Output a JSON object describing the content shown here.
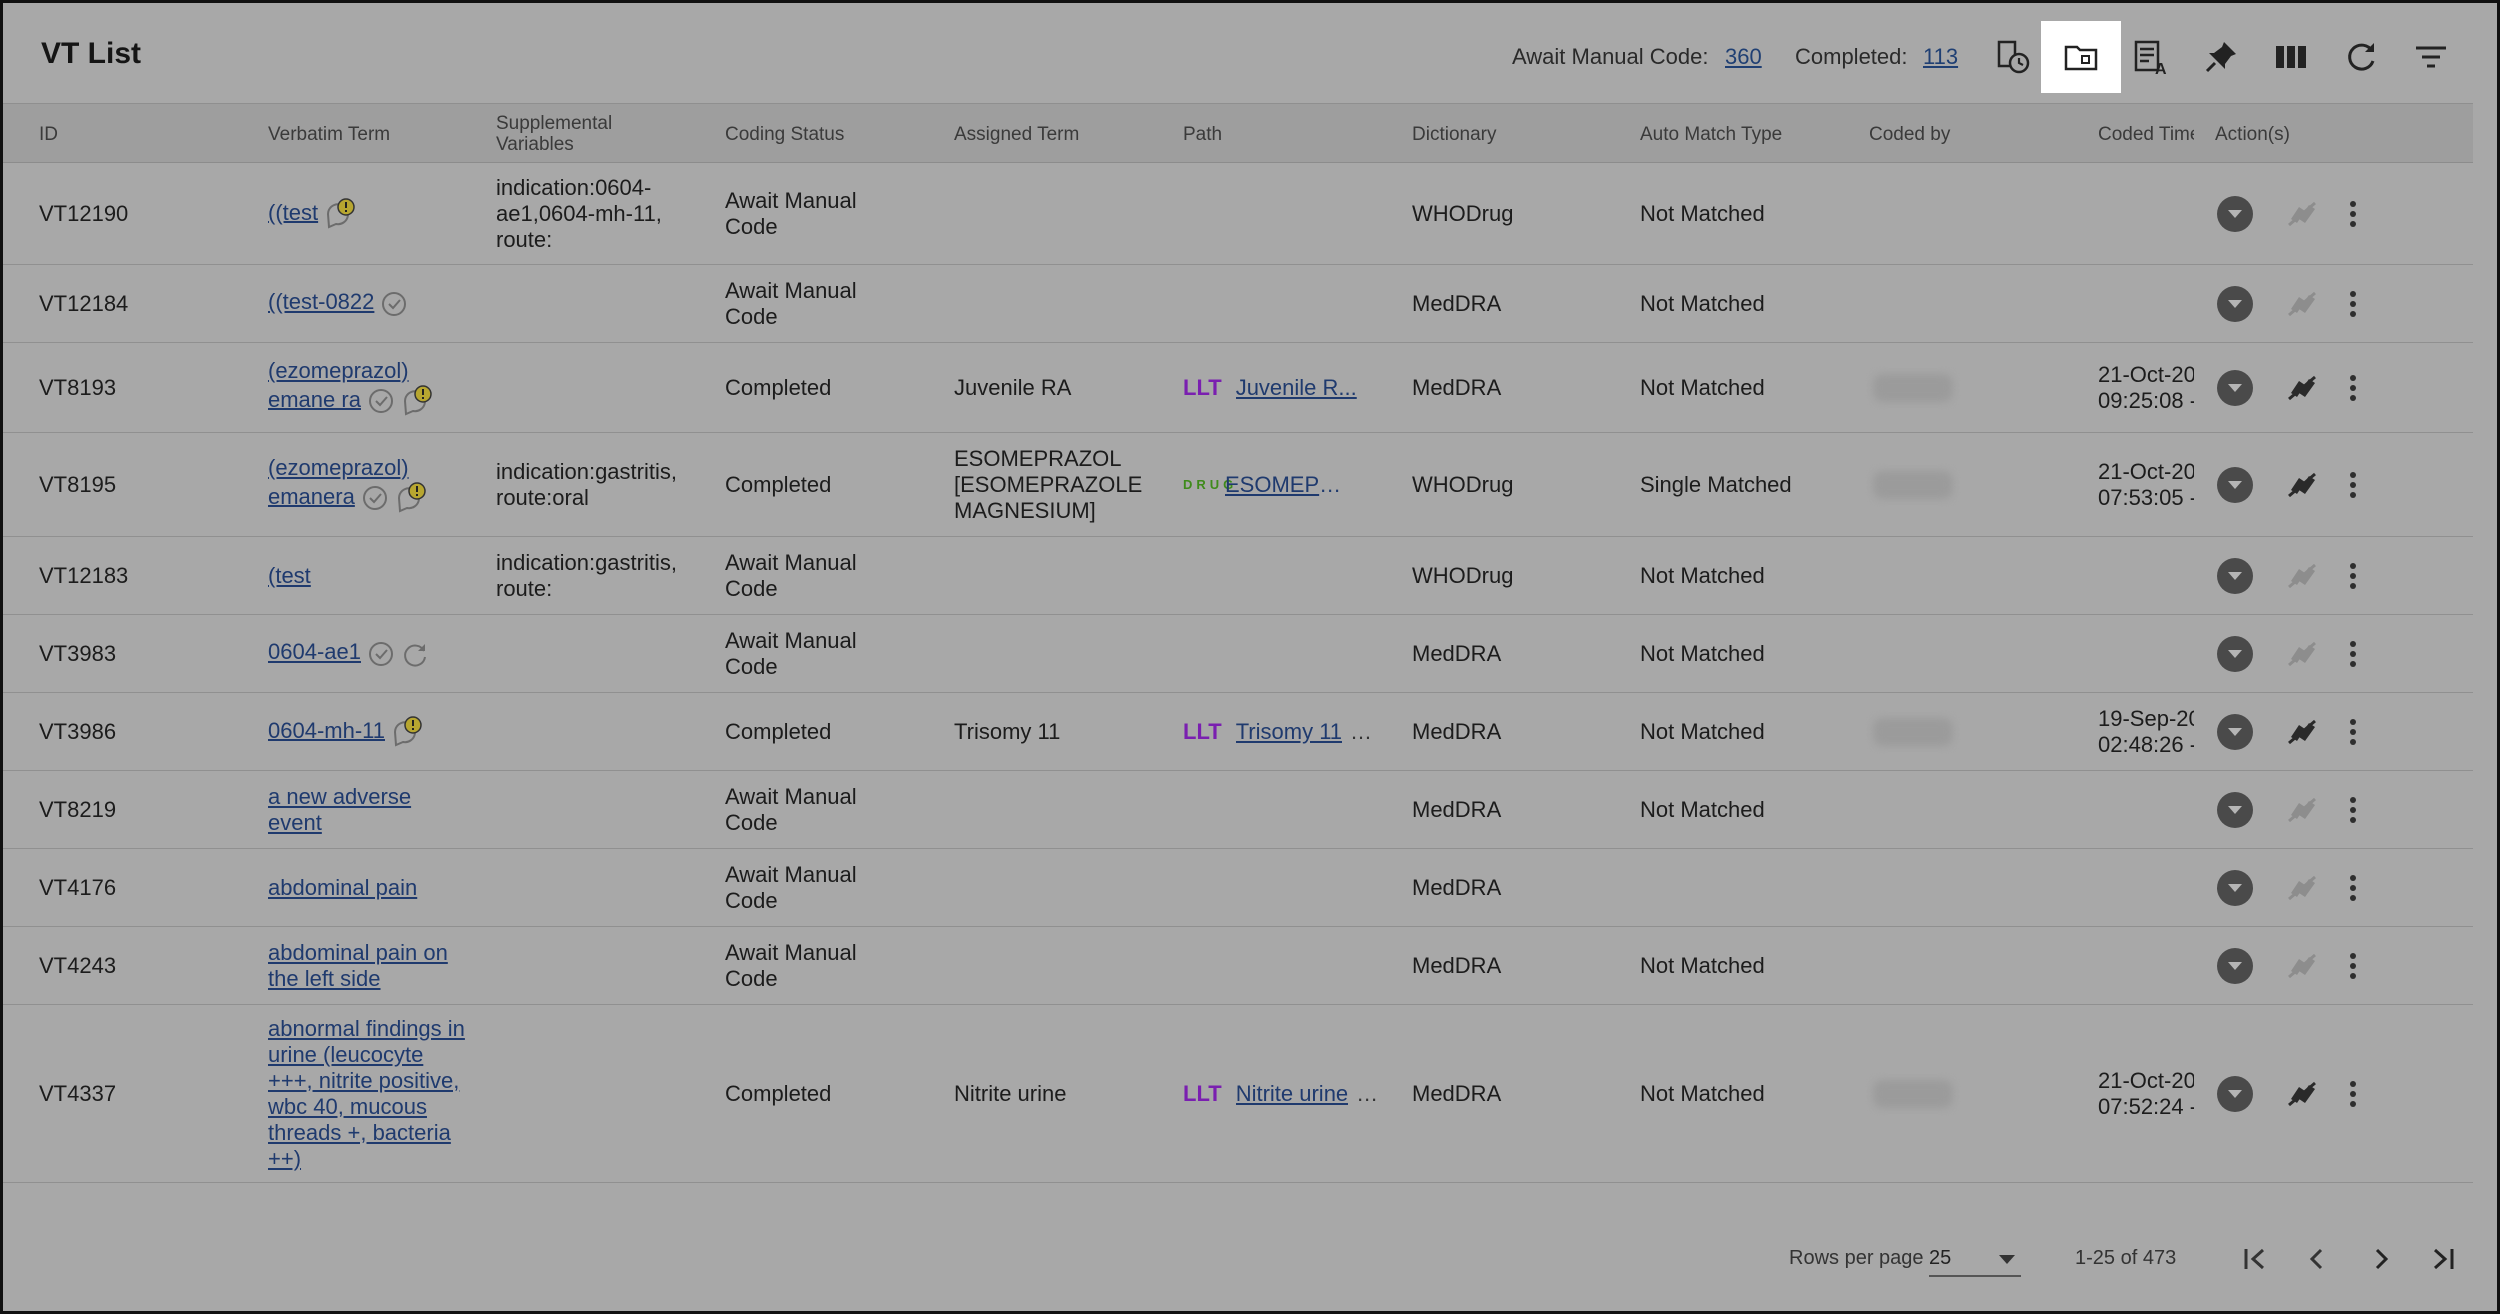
{
  "header": {
    "title": "VT List",
    "await_label": "Await Manual Code:",
    "await_count": "360",
    "completed_label": "Completed:",
    "completed_count": "113",
    "icons": [
      "history-icon",
      "folder-icon",
      "report-icon",
      "pin-icon",
      "columns-icon",
      "refresh-icon",
      "filter-icon"
    ]
  },
  "columns": {
    "id": "ID",
    "verbatim": "Verbatim Term",
    "supp": "Supplemental Variables",
    "status": "Coding Status",
    "assigned": "Assigned Term",
    "path": "Path",
    "dict": "Dictionary",
    "auto": "Auto Match Type",
    "coded_by": "Coded by",
    "coded_time": "Coded Time",
    "actions": "Action(s)"
  },
  "rows": [
    {
      "id": "VT12190",
      "verbatim": "((test",
      "supp": "indication:0604-ae1,0604-mh-11, route:",
      "status": "Await Manual Code",
      "assigned": "",
      "path_type": "",
      "path": "",
      "dict": "WHODrug",
      "auto": "Not Matched",
      "time1": "",
      "time2": "",
      "icons": [
        "query-warning-icon"
      ]
    },
    {
      "id": "VT12184",
      "verbatim": "((test-0822",
      "supp": "",
      "status": "Await Manual Code",
      "assigned": "",
      "path_type": "",
      "path": "",
      "dict": "MedDRA",
      "auto": "Not Matched",
      "time1": "",
      "time2": "",
      "icons": [
        "check-circle-icon"
      ]
    },
    {
      "id": "VT8193",
      "verbatim": "(ezomeprazol) emane ra",
      "supp": "",
      "status": "Completed",
      "assigned": "Juvenile RA",
      "path_type": "LLT",
      "path": "Juvenile R...",
      "dict": "MedDRA",
      "auto": "Not Matched",
      "time1": "21-Oct-20",
      "time2": "09:25:08 -",
      "icons": [
        "check-circle-icon",
        "query-warning-icon"
      ]
    },
    {
      "id": "VT8195",
      "verbatim": "(ezomeprazol) emanera",
      "supp": "indication:gastritis, route:oral",
      "status": "Completed",
      "assigned": "ESOMEPRAZOL [ESOMEPRAZOLE MAGNESIUM]",
      "path_type": "DRUG",
      "path": "ESOMEPRA...",
      "dict": "WHODrug",
      "auto": "Single Matched",
      "time1": "21-Oct-20",
      "time2": "07:53:05 -",
      "icons": [
        "check-circle-icon",
        "query-warning-icon"
      ]
    },
    {
      "id": "VT12183",
      "verbatim": "(test",
      "supp": "indication:gastritis, route:",
      "status": "Await Manual Code",
      "assigned": "",
      "path_type": "",
      "path": "",
      "dict": "WHODrug",
      "auto": "Not Matched",
      "time1": "",
      "time2": "",
      "icons": []
    },
    {
      "id": "VT3983",
      "verbatim": "0604-ae1",
      "supp": "",
      "status": "Await Manual Code",
      "assigned": "",
      "path_type": "",
      "path": "",
      "dict": "MedDRA",
      "auto": "Not Matched",
      "time1": "",
      "time2": "",
      "icons": [
        "check-circle-icon",
        "refresh-circle-icon"
      ]
    },
    {
      "id": "VT3986",
      "verbatim": "0604-mh-11",
      "supp": "",
      "status": "Completed",
      "assigned": "Trisomy 11",
      "path_type": "LLT",
      "path": "Trisomy 11",
      "dict": "MedDRA",
      "auto": "Not Matched",
      "time1": "19-Sep-20",
      "time2": "02:48:26 -",
      "icons": [
        "query-warning-icon"
      ]
    },
    {
      "id": "VT8219",
      "verbatim": "a new adverse event",
      "supp": "",
      "status": "Await Manual Code",
      "assigned": "",
      "path_type": "",
      "path": "",
      "dict": "MedDRA",
      "auto": "Not Matched",
      "time1": "",
      "time2": "",
      "icons": []
    },
    {
      "id": "VT4176",
      "verbatim": "abdominal pain",
      "supp": "",
      "status": "Await Manual Code",
      "assigned": "",
      "path_type": "",
      "path": "",
      "dict": "MedDRA",
      "auto": "",
      "time1": "",
      "time2": "",
      "icons": []
    },
    {
      "id": "VT4243",
      "verbatim": "abdominal pain on the left side",
      "supp": "",
      "status": "Await Manual Code",
      "assigned": "",
      "path_type": "",
      "path": "",
      "dict": "MedDRA",
      "auto": "Not Matched",
      "time1": "",
      "time2": "",
      "icons": []
    },
    {
      "id": "VT4337",
      "verbatim": "abnormal findings in urine (leucocyte +++, nitrite positive, wbc 40, mucous threads +, bacteria ++)",
      "supp": "",
      "status": "Completed",
      "assigned": "Nitrite urine",
      "path_type": "LLT",
      "path": "Nitrite urine",
      "dict": "MedDRA",
      "auto": "Not Matched",
      "time1": "21-Oct-20",
      "time2": "07:52:24 -",
      "icons": []
    }
  ],
  "footer": {
    "rows_per_page_label": "Rows per page",
    "rows_per_page_value": "25",
    "range": "1-25 of 473"
  },
  "colors": {
    "llt": "#7a1fb0",
    "drug": "#3f8b1b",
    "link": "#1f3a6e"
  }
}
